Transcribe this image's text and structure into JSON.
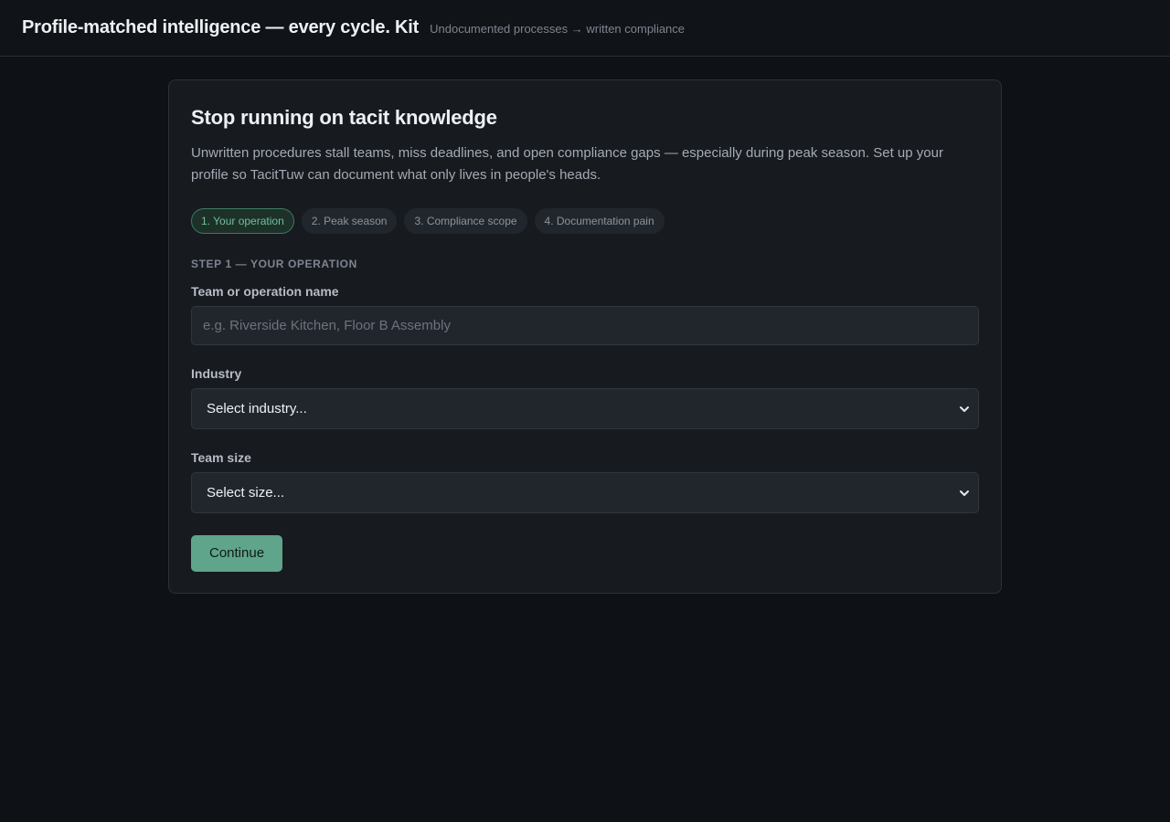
{
  "header": {
    "title": "Profile-matched intelligence — every cycle. Kit",
    "tagline": "Undocumented processes → written compliance"
  },
  "card": {
    "heading": "Stop running on tacit knowledge",
    "intro": "Unwritten procedures stall teams, miss deadlines, and open compliance gaps — especially during peak season. Set up your profile so TacitTuw can document what only lives in people's heads.",
    "steps": [
      {
        "label": "1. Your operation",
        "active": true
      },
      {
        "label": "2. Peak season",
        "active": false
      },
      {
        "label": "3. Compliance scope",
        "active": false
      },
      {
        "label": "4. Documentation pain",
        "active": false
      }
    ],
    "section_label": "STEP 1 — YOUR OPERATION",
    "fields": {
      "team_name": {
        "label": "Team or operation name",
        "placeholder": "e.g. Riverside Kitchen, Floor B Assembly",
        "value": ""
      },
      "industry": {
        "label": "Industry",
        "selected": "Select industry..."
      },
      "team_size": {
        "label": "Team size",
        "selected": "Select size..."
      }
    },
    "continue_label": "Continue"
  },
  "icons": {
    "select_chevron": "chevron-down-icon"
  },
  "colors": {
    "accent": "#5ea58b",
    "active_step_text": "#6fbf9f",
    "background": "#0e1115",
    "card": "#171a1f"
  }
}
